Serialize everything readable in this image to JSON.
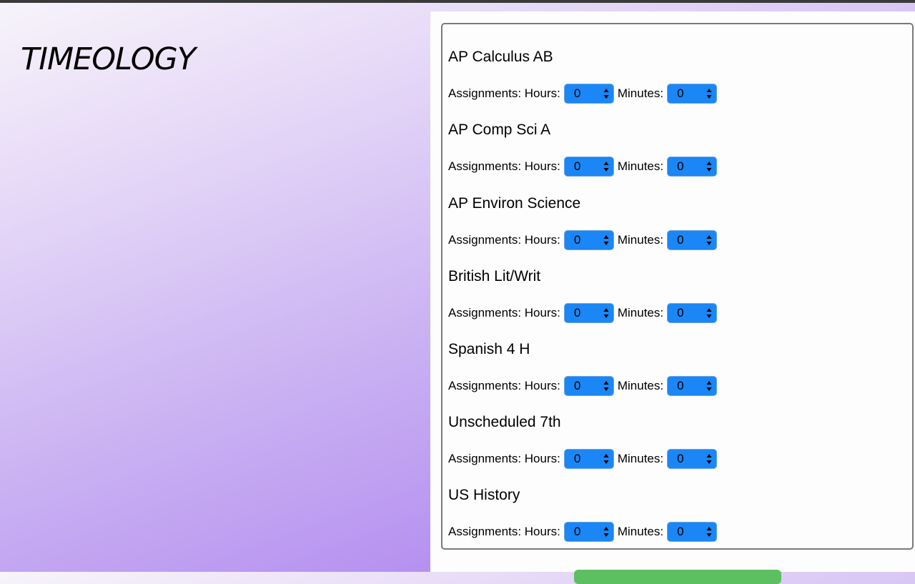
{
  "app": {
    "brand": "TIMEOLOGY"
  },
  "labels": {
    "assignments_hours": "Assignments: Hours:",
    "minutes": "Minutes:"
  },
  "courses": [
    {
      "name": "AP Calculus AB",
      "hours": "0",
      "minutes": "0"
    },
    {
      "name": "AP Comp Sci A",
      "hours": "0",
      "minutes": "0"
    },
    {
      "name": "AP Environ Science",
      "hours": "0",
      "minutes": "0"
    },
    {
      "name": "British Lit/Writ",
      "hours": "0",
      "minutes": "0"
    },
    {
      "name": "Spanish 4 H",
      "hours": "0",
      "minutes": "0"
    },
    {
      "name": "Unscheduled 7th",
      "hours": "0",
      "minutes": "0"
    },
    {
      "name": "US History",
      "hours": "0",
      "minutes": "0"
    }
  ],
  "colors": {
    "select_bg": "#1b86f5",
    "submit_button": "#5cc060",
    "gradient_end": "#a679ef"
  }
}
